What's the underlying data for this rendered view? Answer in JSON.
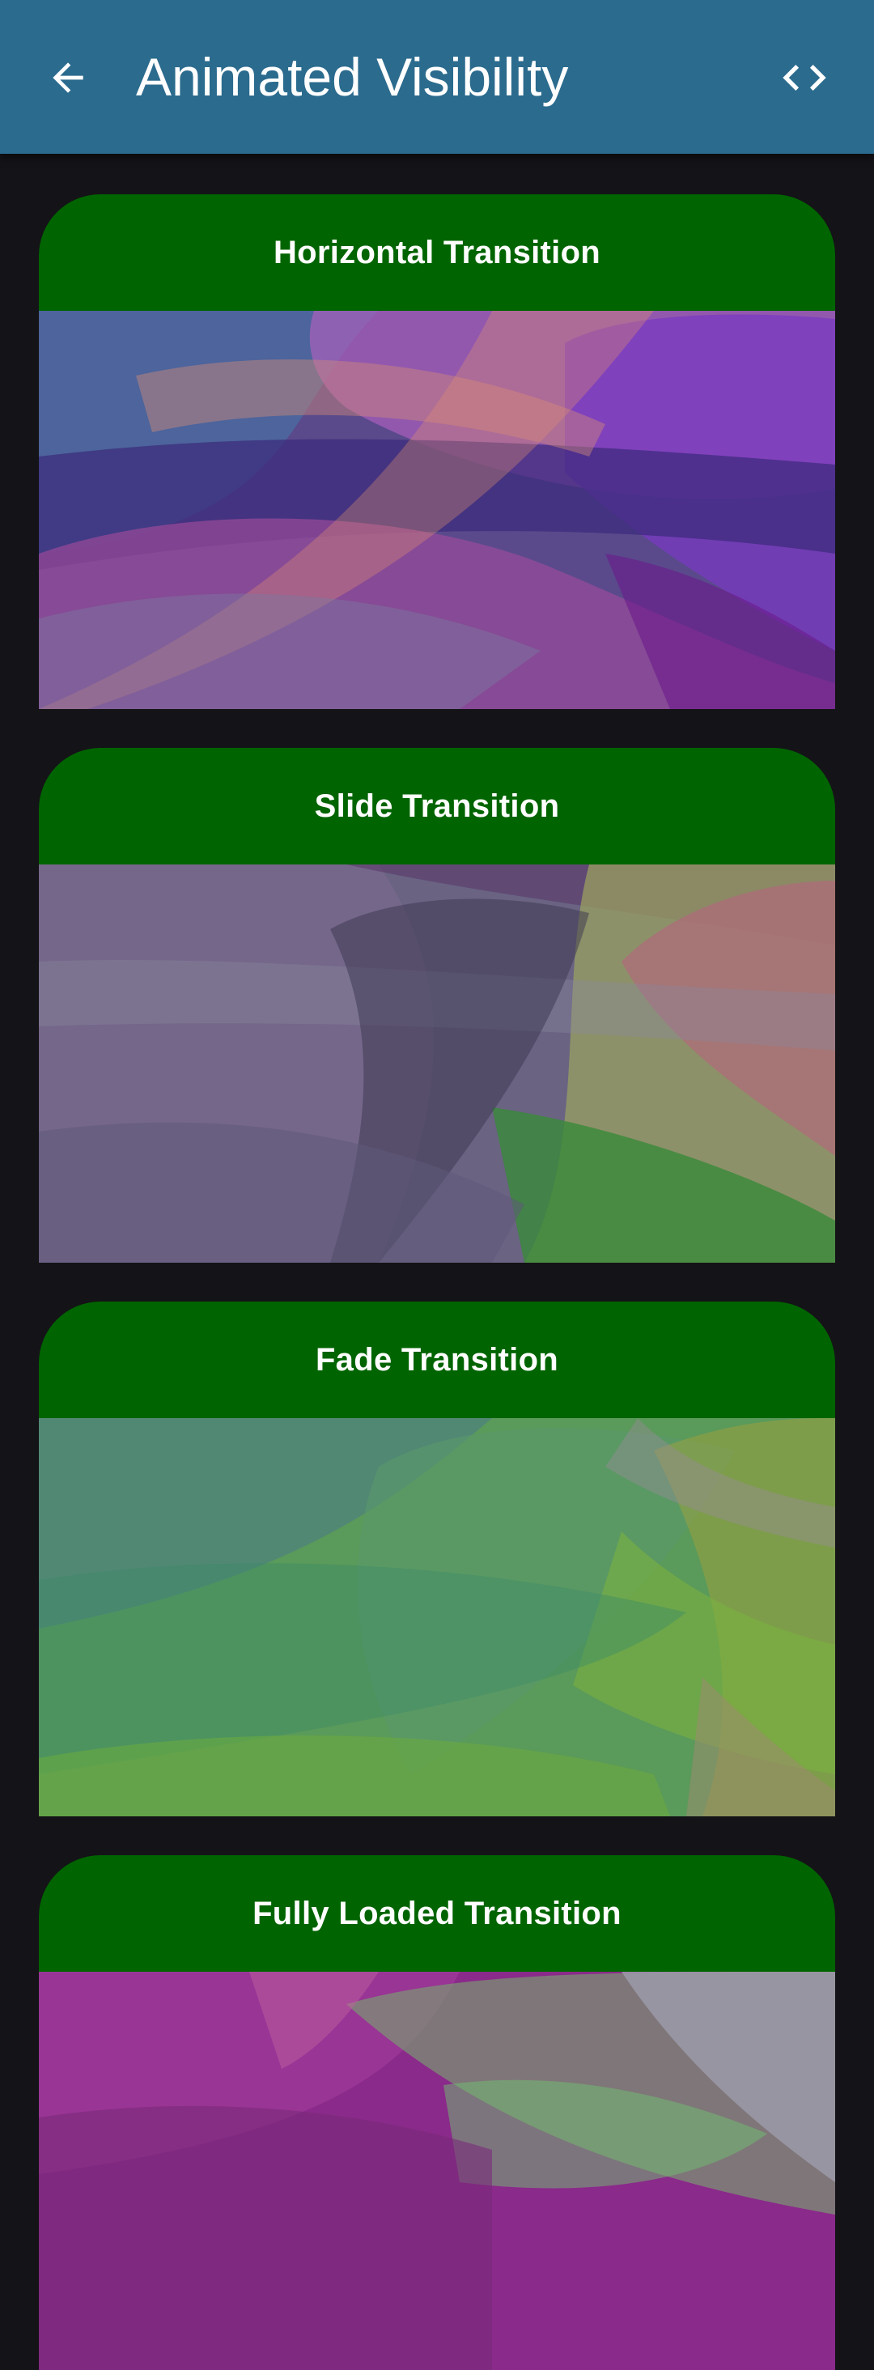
{
  "app_bar": {
    "title": "Animated Visibility",
    "back_icon": "arrow-back-icon",
    "code_icon": "code-icon",
    "background": "#2b6b8e"
  },
  "cards": [
    {
      "title": "Horizontal Transition",
      "header_color": "#006400",
      "palette": "purple-blue-orange"
    },
    {
      "title": "Slide Transition",
      "header_color": "#006400",
      "palette": "grey-violet-green-rose"
    },
    {
      "title": "Fade Transition",
      "header_color": "#006400",
      "palette": "green-teal-olive"
    },
    {
      "title": "Fully Loaded Transition",
      "header_color": "#006400",
      "palette": "magenta-green-grey"
    }
  ]
}
